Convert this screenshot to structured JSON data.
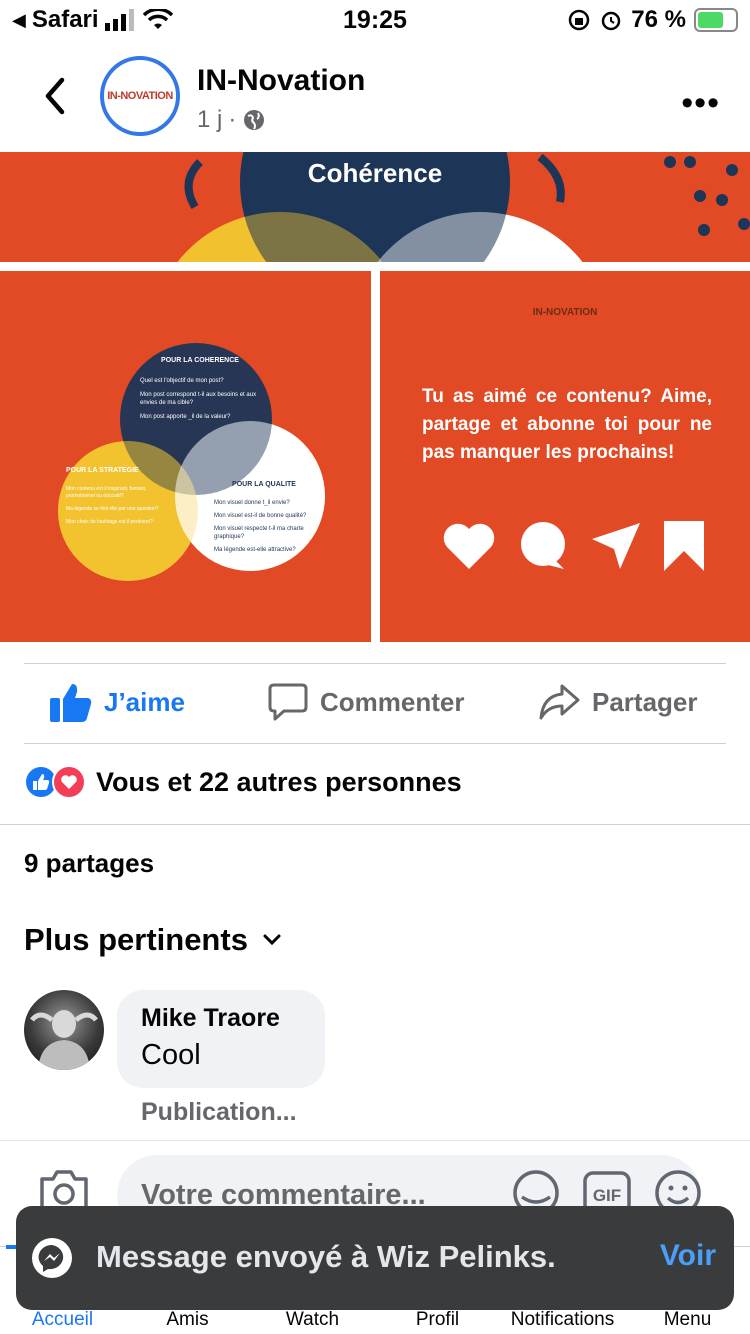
{
  "status_bar": {
    "carrier": "Safari",
    "time": "19:25",
    "battery": "76 %"
  },
  "header": {
    "page_name": "IN-Novation",
    "post_time": "1 j",
    "separator": "·",
    "avatar_logo_text": "IN-NOVATION"
  },
  "post_images": {
    "top_title": "Cohérence",
    "venn": {
      "coherence_title": "POUR LA COHERENCE",
      "coherence_lines": [
        "Quel est l'objectif de mon post?",
        "Mon post correspond t-il aux besoins et aux envies de ma cible?",
        "Mon post apporte _il de la valeur?"
      ],
      "strategie_title": "POUR LA STRATEGIE",
      "strategie_lines": [
        "Mon contenu est il inspirant, fumant, promotionnel ou éducatif?",
        "Ma légende se finit elle par une question?",
        "Mon choix de hashtags est il pertinent?"
      ],
      "qualite_title": "POUR LA QUALITE",
      "qualite_lines": [
        "Mon visuel donne t_il envie?",
        "Mon visuel est-il de bonne qualité?",
        "Mon visuel respecte t-il ma charte graphique?",
        "Ma légende est-elle attractive?"
      ]
    },
    "cta_logo": "IN-NOVATION",
    "cta_text": "Tu as aimé ce contenu? Aime, partage et abonne toi pour ne pas manquer les prochains!"
  },
  "actions": {
    "like": "J’aime",
    "comment": "Commenter",
    "share": "Partager"
  },
  "reactions_summary": "Vous et 22 autres personnes",
  "shares_count": "9 partages",
  "sort_label": "Plus pertinents",
  "comment": {
    "author": "Mike Traore",
    "text": "Cool",
    "meta": "Publication..."
  },
  "composer": {
    "placeholder": "Votre commentaire..."
  },
  "toast": {
    "message": "Message envoyé à Wiz Pelinks.",
    "action": "Voir"
  },
  "tabs": [
    {
      "label": "Accueil"
    },
    {
      "label": "Amis"
    },
    {
      "label": "Watch"
    },
    {
      "label": "Profil"
    },
    {
      "label": "Notifications"
    },
    {
      "label": "Menu"
    }
  ],
  "colors": {
    "accent": "#1877f2",
    "post_orange": "#e24a26",
    "navy": "#1d3557",
    "yellow": "#f2c230"
  }
}
